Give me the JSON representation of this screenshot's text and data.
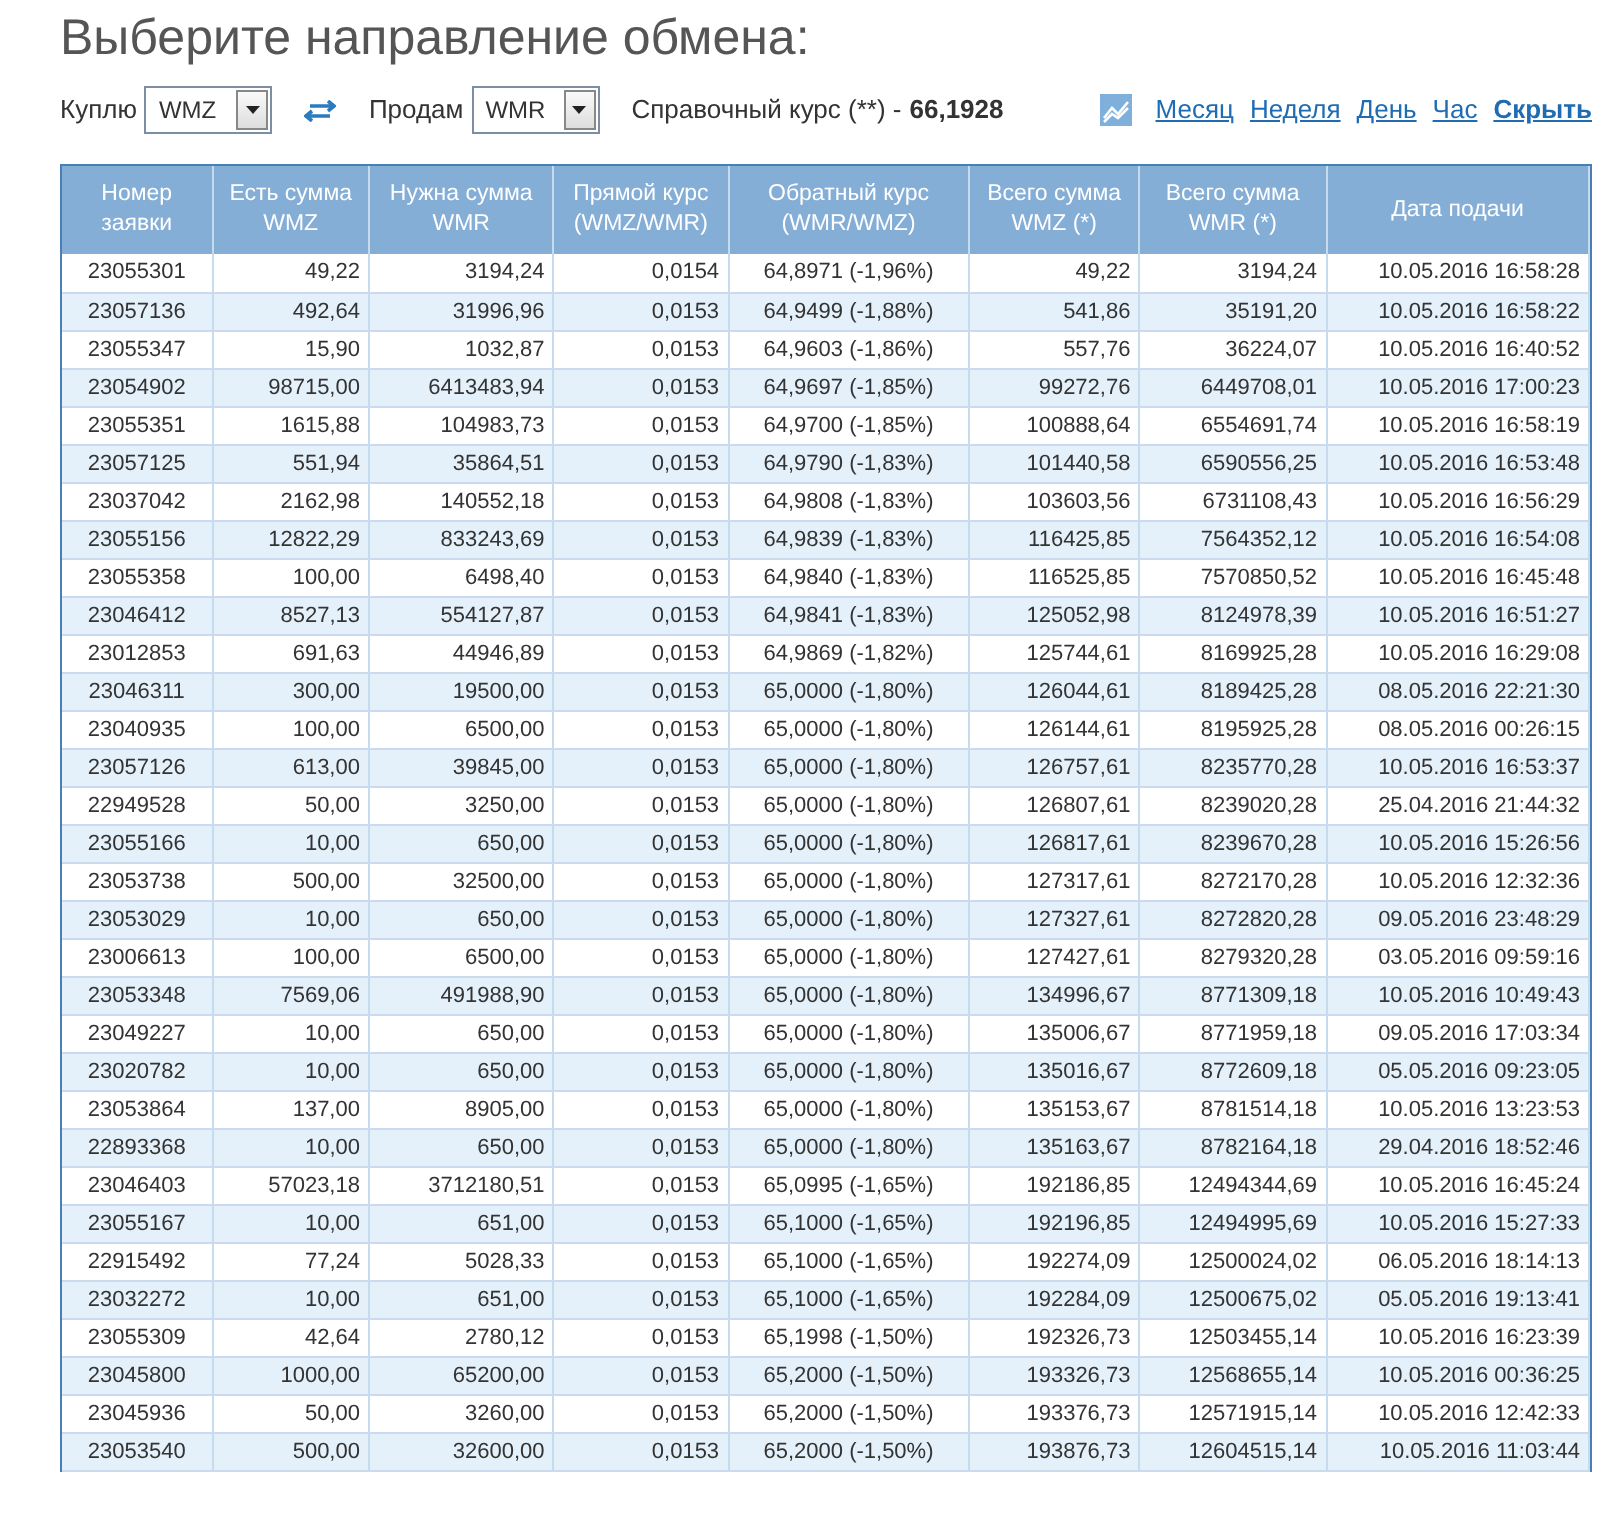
{
  "title": "Выберите направление обмена:",
  "controls": {
    "buy_label": "Куплю",
    "buy_value": "WMZ",
    "sell_label": "Продам",
    "sell_value": "WMR",
    "rate_label": "Справочный курс (**) -",
    "rate_value": "66,1928",
    "periods": [
      {
        "label": "Месяц"
      },
      {
        "label": "Неделя"
      },
      {
        "label": "День"
      },
      {
        "label": "Час"
      }
    ],
    "hide_link": "Скрыть"
  },
  "table": {
    "columns": [
      "Номер заявки",
      "Есть сумма WMZ",
      "Нужна сумма WMR",
      "Прямой курс (WMZ/WMR)",
      "Обратный курс (WMR/WMZ)",
      "Всего сумма WMZ (*)",
      "Всего сумма WMR (*)",
      "Дата подачи"
    ],
    "rows": [
      [
        "23055301",
        "49,22",
        "3194,24",
        "0,0154",
        "64,8971 (-1,96%)",
        "49,22",
        "3194,24",
        "10.05.2016 16:58:28"
      ],
      [
        "23057136",
        "492,64",
        "31996,96",
        "0,0153",
        "64,9499 (-1,88%)",
        "541,86",
        "35191,20",
        "10.05.2016 16:58:22"
      ],
      [
        "23055347",
        "15,90",
        "1032,87",
        "0,0153",
        "64,9603 (-1,86%)",
        "557,76",
        "36224,07",
        "10.05.2016 16:40:52"
      ],
      [
        "23054902",
        "98715,00",
        "6413483,94",
        "0,0153",
        "64,9697 (-1,85%)",
        "99272,76",
        "6449708,01",
        "10.05.2016 17:00:23"
      ],
      [
        "23055351",
        "1615,88",
        "104983,73",
        "0,0153",
        "64,9700 (-1,85%)",
        "100888,64",
        "6554691,74",
        "10.05.2016 16:58:19"
      ],
      [
        "23057125",
        "551,94",
        "35864,51",
        "0,0153",
        "64,9790 (-1,83%)",
        "101440,58",
        "6590556,25",
        "10.05.2016 16:53:48"
      ],
      [
        "23037042",
        "2162,98",
        "140552,18",
        "0,0153",
        "64,9808 (-1,83%)",
        "103603,56",
        "6731108,43",
        "10.05.2016 16:56:29"
      ],
      [
        "23055156",
        "12822,29",
        "833243,69",
        "0,0153",
        "64,9839 (-1,83%)",
        "116425,85",
        "7564352,12",
        "10.05.2016 16:54:08"
      ],
      [
        "23055358",
        "100,00",
        "6498,40",
        "0,0153",
        "64,9840 (-1,83%)",
        "116525,85",
        "7570850,52",
        "10.05.2016 16:45:48"
      ],
      [
        "23046412",
        "8527,13",
        "554127,87",
        "0,0153",
        "64,9841 (-1,83%)",
        "125052,98",
        "8124978,39",
        "10.05.2016 16:51:27"
      ],
      [
        "23012853",
        "691,63",
        "44946,89",
        "0,0153",
        "64,9869 (-1,82%)",
        "125744,61",
        "8169925,28",
        "10.05.2016 16:29:08"
      ],
      [
        "23046311",
        "300,00",
        "19500,00",
        "0,0153",
        "65,0000 (-1,80%)",
        "126044,61",
        "8189425,28",
        "08.05.2016 22:21:30"
      ],
      [
        "23040935",
        "100,00",
        "6500,00",
        "0,0153",
        "65,0000 (-1,80%)",
        "126144,61",
        "8195925,28",
        "08.05.2016 00:26:15"
      ],
      [
        "23057126",
        "613,00",
        "39845,00",
        "0,0153",
        "65,0000 (-1,80%)",
        "126757,61",
        "8235770,28",
        "10.05.2016 16:53:37"
      ],
      [
        "22949528",
        "50,00",
        "3250,00",
        "0,0153",
        "65,0000 (-1,80%)",
        "126807,61",
        "8239020,28",
        "25.04.2016 21:44:32"
      ],
      [
        "23055166",
        "10,00",
        "650,00",
        "0,0153",
        "65,0000 (-1,80%)",
        "126817,61",
        "8239670,28",
        "10.05.2016 15:26:56"
      ],
      [
        "23053738",
        "500,00",
        "32500,00",
        "0,0153",
        "65,0000 (-1,80%)",
        "127317,61",
        "8272170,28",
        "10.05.2016 12:32:36"
      ],
      [
        "23053029",
        "10,00",
        "650,00",
        "0,0153",
        "65,0000 (-1,80%)",
        "127327,61",
        "8272820,28",
        "09.05.2016 23:48:29"
      ],
      [
        "23006613",
        "100,00",
        "6500,00",
        "0,0153",
        "65,0000 (-1,80%)",
        "127427,61",
        "8279320,28",
        "03.05.2016 09:59:16"
      ],
      [
        "23053348",
        "7569,06",
        "491988,90",
        "0,0153",
        "65,0000 (-1,80%)",
        "134996,67",
        "8771309,18",
        "10.05.2016 10:49:43"
      ],
      [
        "23049227",
        "10,00",
        "650,00",
        "0,0153",
        "65,0000 (-1,80%)",
        "135006,67",
        "8771959,18",
        "09.05.2016 17:03:34"
      ],
      [
        "23020782",
        "10,00",
        "650,00",
        "0,0153",
        "65,0000 (-1,80%)",
        "135016,67",
        "8772609,18",
        "05.05.2016 09:23:05"
      ],
      [
        "23053864",
        "137,00",
        "8905,00",
        "0,0153",
        "65,0000 (-1,80%)",
        "135153,67",
        "8781514,18",
        "10.05.2016 13:23:53"
      ],
      [
        "22893368",
        "10,00",
        "650,00",
        "0,0153",
        "65,0000 (-1,80%)",
        "135163,67",
        "8782164,18",
        "29.04.2016 18:52:46"
      ],
      [
        "23046403",
        "57023,18",
        "3712180,51",
        "0,0153",
        "65,0995 (-1,65%)",
        "192186,85",
        "12494344,69",
        "10.05.2016 16:45:24"
      ],
      [
        "23055167",
        "10,00",
        "651,00",
        "0,0153",
        "65,1000 (-1,65%)",
        "192196,85",
        "12494995,69",
        "10.05.2016 15:27:33"
      ],
      [
        "22915492",
        "77,24",
        "5028,33",
        "0,0153",
        "65,1000 (-1,65%)",
        "192274,09",
        "12500024,02",
        "06.05.2016 18:14:13"
      ],
      [
        "23032272",
        "10,00",
        "651,00",
        "0,0153",
        "65,1000 (-1,65%)",
        "192284,09",
        "12500675,02",
        "05.05.2016 19:13:41"
      ],
      [
        "23055309",
        "42,64",
        "2780,12",
        "0,0153",
        "65,1998 (-1,50%)",
        "192326,73",
        "12503455,14",
        "10.05.2016 16:23:39"
      ],
      [
        "23045800",
        "1000,00",
        "65200,00",
        "0,0153",
        "65,2000 (-1,50%)",
        "193326,73",
        "12568655,14",
        "10.05.2016 00:36:25"
      ],
      [
        "23045936",
        "50,00",
        "3260,00",
        "0,0153",
        "65,2000 (-1,50%)",
        "193376,73",
        "12571915,14",
        "10.05.2016 12:42:33"
      ],
      [
        "23053540",
        "500,00",
        "32600,00",
        "0,0153",
        "65,2000 (-1,50%)",
        "193876,73",
        "12604515,14",
        "10.05.2016 11:03:44"
      ]
    ]
  }
}
